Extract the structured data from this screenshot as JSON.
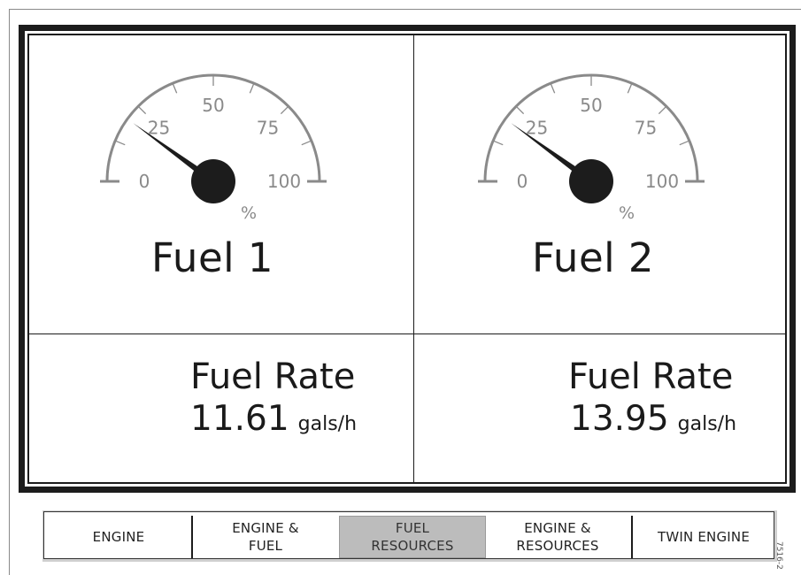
{
  "gauges": [
    {
      "title": "Fuel 1",
      "unit": "%",
      "level_percent": 20,
      "scale_labels": [
        "0",
        "25",
        "50",
        "75",
        "100"
      ],
      "fuel_rate": {
        "label": "Fuel Rate",
        "value": "11.61",
        "unit": "gals/h"
      }
    },
    {
      "title": "Fuel 2",
      "unit": "%",
      "level_percent": 20,
      "scale_labels": [
        "0",
        "25",
        "50",
        "75",
        "100"
      ],
      "fuel_rate": {
        "label": "Fuel Rate",
        "value": "13.95",
        "unit": "gals/h"
      }
    }
  ],
  "softkeys": [
    {
      "label_line1": "ENGINE",
      "label_line2": "",
      "active": false
    },
    {
      "label_line1": "ENGINE &",
      "label_line2": "FUEL",
      "active": false
    },
    {
      "label_line1": "FUEL",
      "label_line2": "RESOURCES",
      "active": true
    },
    {
      "label_line1": "ENGINE &",
      "label_line2": "RESOURCES",
      "active": false
    },
    {
      "label_line1": "TWIN ENGINE",
      "label_line2": "",
      "active": false
    }
  ],
  "figure_code": "7516-2",
  "colors": {
    "frame": "#1c1c1c",
    "gauge_arc": "#8a8a8a",
    "needle": "#1c1c1c",
    "scale_text": "#8a8a8a",
    "active_softkey": "#bcbcbc"
  }
}
